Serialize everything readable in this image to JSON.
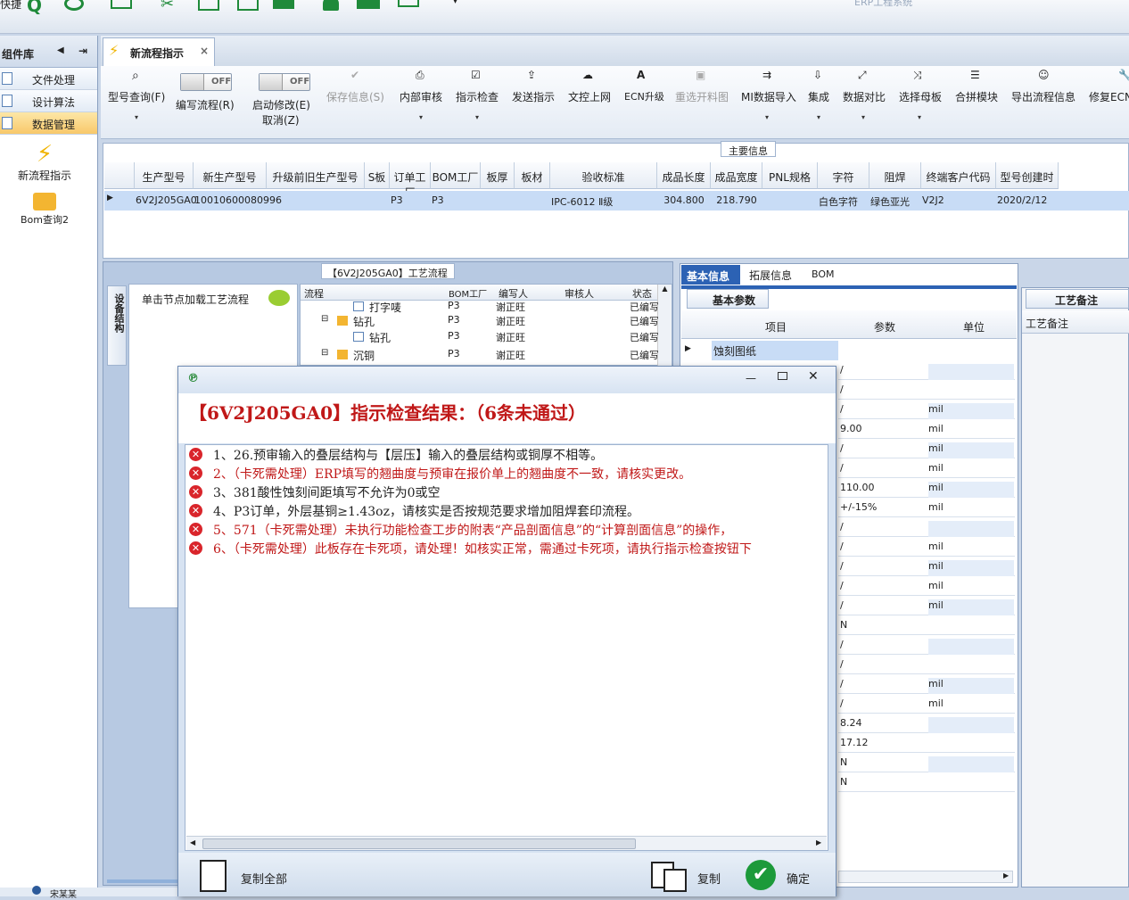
{
  "topbar": {
    "left_fragment": "快捷",
    "right_fragment": "ERP工程系统"
  },
  "left": {
    "header": "组件库",
    "nav": [
      "文件处理",
      "设计算法",
      "数据管理"
    ],
    "tools": [
      "新流程指示",
      "Bom查询2"
    ],
    "footer": "宋某某"
  },
  "tab": {
    "label": "新流程指示",
    "close": "×"
  },
  "ribbon": {
    "items": [
      {
        "label": "型号查询(F)",
        "icon": "search-icon"
      },
      {
        "label": "编写流程(R)",
        "toggle": "OFF"
      },
      {
        "label": "启动修改(E)",
        "sub": "取消(Z)",
        "toggle": "OFF"
      },
      {
        "label": "保存信息(S)",
        "icon": "check-icon"
      },
      {
        "label": "内部审核",
        "icon": "print-icon"
      },
      {
        "label": "指示检查",
        "icon": "checklist-icon"
      },
      {
        "label": "发送指示",
        "icon": "upload-icon"
      },
      {
        "label": "文控上网",
        "icon": "cloud-icon"
      },
      {
        "label": "ECN升级",
        "icon": "ecn-icon"
      },
      {
        "label": "重选开料图",
        "icon": "image-icon"
      },
      {
        "label": "MI数据导入",
        "icon": "import-icon"
      },
      {
        "label": "集成",
        "icon": "download-icon"
      },
      {
        "label": "数据对比",
        "icon": "compare-icon"
      },
      {
        "label": "选择母板",
        "icon": "shuffle-icon"
      },
      {
        "label": "合拼模块",
        "icon": "list-icon"
      },
      {
        "label": "导出流程信息",
        "icon": "smile-icon"
      },
      {
        "label": "修复ECN",
        "icon": "wrench-icon"
      }
    ]
  },
  "main_info": {
    "title": "主要信息",
    "columns": [
      "生产型号",
      "新生产型号",
      "升级前旧生产型号",
      "S板",
      "订单工厂",
      "BOM工厂",
      "板厚",
      "板材",
      "验收标准",
      "成品长度",
      "成品宽度",
      "PNL规格",
      "字符",
      "阻焊",
      "终端客户代码",
      "型号创建时"
    ],
    "row": [
      "6V2J205GA0",
      "10010600080996",
      "",
      "",
      "P3",
      "P3",
      "",
      "",
      "IPC-6012 Ⅱ级",
      "304.800",
      "218.790",
      "",
      "白色字符",
      "绿色亚光",
      "V2J2",
      "2020/2/12"
    ]
  },
  "process": {
    "title": "【6V2J205GA0】工艺流程",
    "side_tab": "设备结构",
    "hint": "单击节点加载工艺流程",
    "columns": [
      "流程",
      "BOM工厂",
      "编写人",
      "审核人",
      "状态"
    ],
    "rows": [
      {
        "name": "打字唛",
        "factory": "P3",
        "writer": "谢正旺",
        "reviewer": "",
        "status": "已编写"
      },
      {
        "name": "钻孔",
        "factory": "P3",
        "writer": "谢正旺",
        "reviewer": "",
        "status": "已编写"
      },
      {
        "name": "钻孔",
        "factory": "P3",
        "writer": "谢正旺",
        "reviewer": "",
        "status": "已编写"
      },
      {
        "name": "沉铜",
        "factory": "P3",
        "writer": "谢正旺",
        "reviewer": "",
        "status": "已编写"
      }
    ]
  },
  "basic": {
    "tabs": [
      "基本信息",
      "拓展信息",
      "BOM"
    ],
    "subtab": "基本参数",
    "columns": [
      "项目",
      "参数",
      "单位"
    ],
    "first_item": "蚀刻图纸",
    "params": [
      {
        "v": "/",
        "u": ""
      },
      {
        "v": "/",
        "u": ""
      },
      {
        "v": "/",
        "u": "mil"
      },
      {
        "v": "9.00",
        "u": "mil"
      },
      {
        "v": "/",
        "u": "mil"
      },
      {
        "v": "/",
        "u": "mil"
      },
      {
        "v": "110.00",
        "u": "mil"
      },
      {
        "v": "+/-15%",
        "u": "mil"
      },
      {
        "v": "/",
        "u": ""
      },
      {
        "v": "/",
        "u": "mil"
      },
      {
        "v": "/",
        "u": "mil"
      },
      {
        "v": "/",
        "u": "mil"
      },
      {
        "v": "/",
        "u": "mil"
      },
      {
        "v": "N",
        "u": ""
      },
      {
        "v": "/",
        "u": ""
      },
      {
        "v": "/",
        "u": ""
      },
      {
        "v": "/",
        "u": "mil"
      },
      {
        "v": "/",
        "u": "mil"
      },
      {
        "v": "8.24",
        "u": ""
      },
      {
        "v": "17.12",
        "u": ""
      },
      {
        "v": "N",
        "u": ""
      },
      {
        "v": "N",
        "u": ""
      }
    ]
  },
  "remark": {
    "tab": "工艺备注",
    "label": "工艺备注"
  },
  "dialog": {
    "title": "【6V2J205GA0】指示检查结果：（6条未通过）",
    "messages": [
      {
        "text": "1、26.预审输入的叠层结构与【层压】输入的叠层结构或铜厚不相等。",
        "red": false
      },
      {
        "text": "2、（卡死需处理）ERP填写的翘曲度与预审在报价单上的翘曲度不一致，请核实更改。",
        "red": true
      },
      {
        "text": "3、381酸性蚀刻间距填写不允许为0或空",
        "red": false
      },
      {
        "text": "4、P3订单，外层基铜≥1.43oz，请核实是否按规范要求增加阻焊套印流程。",
        "red": false
      },
      {
        "text": "5、571（卡死需处理）未执行功能检查工步的附表“产品剖面信息”的“计算剖面信息”的操作，",
        "red": true
      },
      {
        "text": "6、（卡死需处理）此板存在卡死项，请处理！如核实正常，需通过卡死项，请执行指示检查按钮下",
        "red": true
      }
    ],
    "copy_all": "复制全部",
    "copy": "复制",
    "ok": "确定"
  }
}
